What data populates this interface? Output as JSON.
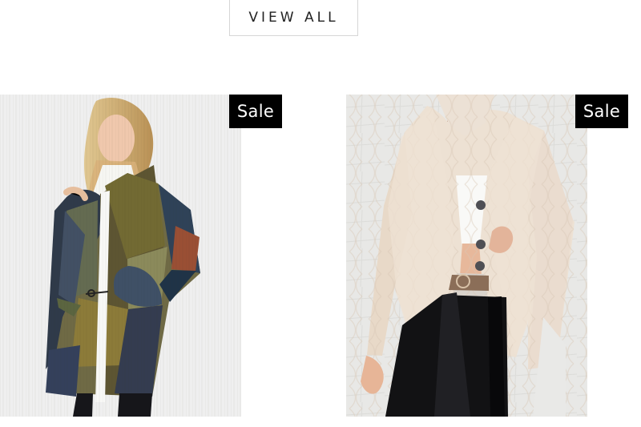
{
  "view_all": {
    "label": "VIEW ALL"
  },
  "products": [
    {
      "badge": "Sale",
      "image_name": "patchwork-cardigan-image"
    },
    {
      "badge": "Sale",
      "image_name": "cream-blazer-image"
    }
  ],
  "colors": {
    "badge_background": "#000000",
    "badge_text": "#ffffff",
    "button_border": "#d6d6d6",
    "button_text": "#222222"
  }
}
